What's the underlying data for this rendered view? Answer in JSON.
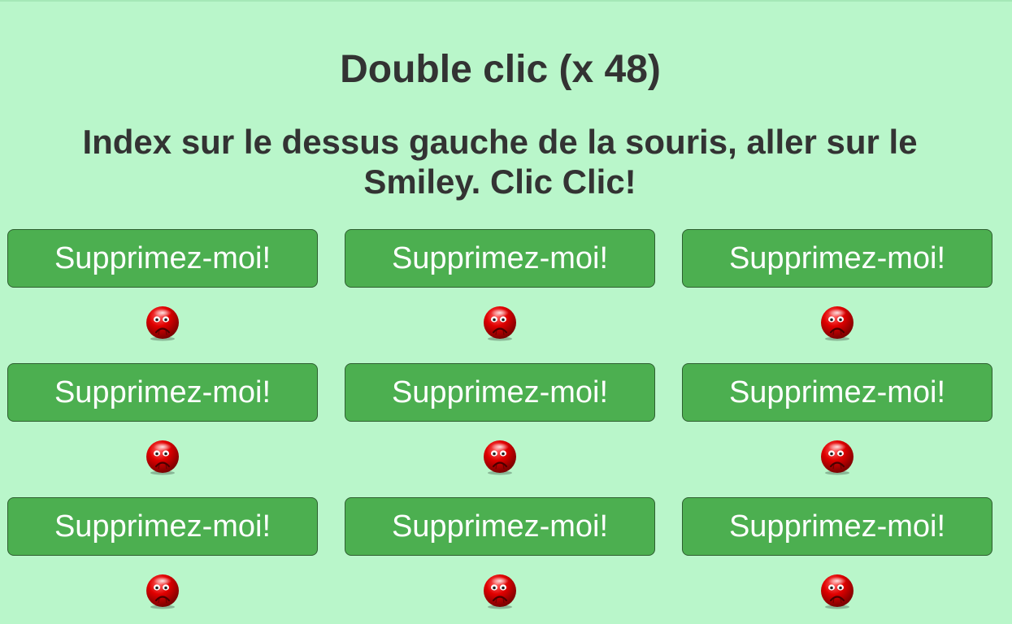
{
  "page": {
    "title": "Double clic (x 48)",
    "instruction": "Index sur le dessus gauche de la souris, aller sur le Smiley. Clic Clic!"
  },
  "grid": {
    "rows": [
      [
        {
          "button_label": "Supprimez-moi!",
          "icon": "sad-smiley-icon"
        },
        {
          "button_label": "Supprimez-moi!",
          "icon": "sad-smiley-icon"
        },
        {
          "button_label": "Supprimez-moi!",
          "icon": "sad-smiley-icon"
        }
      ],
      [
        {
          "button_label": "Supprimez-moi!",
          "icon": "sad-smiley-icon"
        },
        {
          "button_label": "Supprimez-moi!",
          "icon": "sad-smiley-icon"
        },
        {
          "button_label": "Supprimez-moi!",
          "icon": "sad-smiley-icon"
        }
      ],
      [
        {
          "button_label": "Supprimez-moi!",
          "icon": "sad-smiley-icon"
        },
        {
          "button_label": "Supprimez-moi!",
          "icon": "sad-smiley-icon"
        },
        {
          "button_label": "Supprimez-moi!",
          "icon": "sad-smiley-icon"
        }
      ]
    ]
  },
  "colors": {
    "background": "#b9f6ca",
    "button": "#4caf50",
    "text": "#333333",
    "smiley": "#d50000"
  }
}
